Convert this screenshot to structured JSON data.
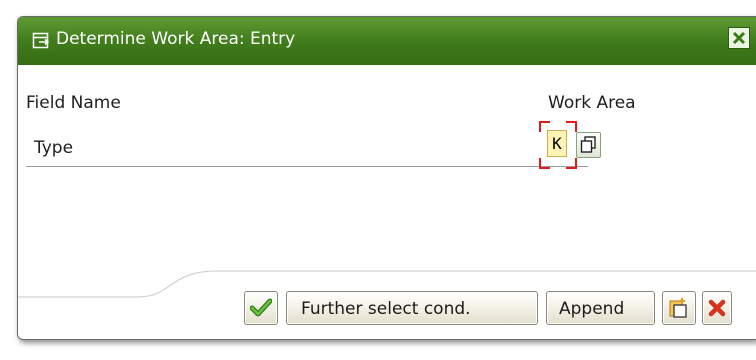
{
  "dialog": {
    "title": "Determine Work Area: Entry",
    "title_icon": "dialog-window-icon",
    "close_icon": "close-x-icon"
  },
  "columns": {
    "field_name": "Field Name",
    "work_area": "Work Area"
  },
  "fields": [
    {
      "name": "Type",
      "work_area_value": "K"
    }
  ],
  "toolbar": {
    "confirm_icon": "checkmark-icon",
    "further_select_label": "Further select cond.",
    "append_label": "Append",
    "new_entry_icon": "new-document-icon",
    "cancel_icon": "cancel-x-icon"
  },
  "colors": {
    "title_bar": "#3f7a1b",
    "input_highlight": "#fff4b6",
    "focus_bracket": "#e21a1a",
    "cancel": "#d6321d",
    "confirm": "#4aa52c"
  }
}
